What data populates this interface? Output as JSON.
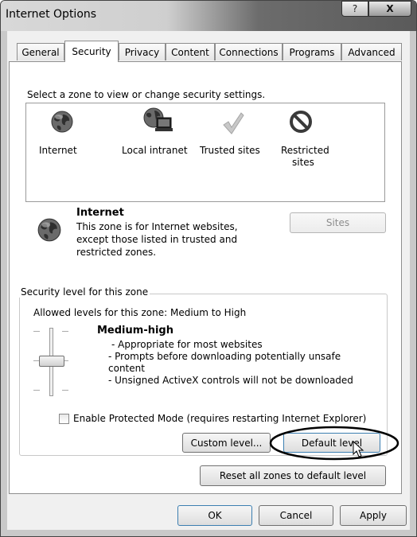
{
  "window": {
    "title": "Internet Options",
    "help_label": "?",
    "close_label": "X"
  },
  "tabs": [
    {
      "label": "General"
    },
    {
      "label": "Security",
      "active": true
    },
    {
      "label": "Privacy"
    },
    {
      "label": "Content"
    },
    {
      "label": "Connections"
    },
    {
      "label": "Programs"
    },
    {
      "label": "Advanced"
    }
  ],
  "zones": {
    "prompt": "Select a zone to view or change security settings.",
    "items": [
      {
        "label": "Internet",
        "icon": "globe-icon"
      },
      {
        "label": "Local intranet",
        "icon": "intranet-icon"
      },
      {
        "label": "Trusted sites",
        "icon": "checkmark-icon"
      },
      {
        "label": "Restricted sites",
        "label_line1": "Restricted",
        "label_line2": "sites",
        "icon": "blocked-icon"
      }
    ]
  },
  "selected_zone": {
    "name": "Internet",
    "description_line1": "This zone is for Internet websites,",
    "description_line2": "except those listed in trusted and",
    "description_line3": "restricted zones.",
    "sites_button": "Sites"
  },
  "security_level": {
    "group_title": "Security level for this zone",
    "allowed": "Allowed levels for this zone: Medium to High",
    "level_name": "Medium-high",
    "bullet1": "- Appropriate for most websites",
    "bullet2_line1": "- Prompts before downloading potentially unsafe",
    "bullet2_line2": "content",
    "bullet3": "- Unsigned ActiveX controls will not be downloaded",
    "slider_level": "Medium-high",
    "protected_mode_label": "Enable Protected Mode (requires restarting Internet Explorer)",
    "protected_mode_checked": false,
    "custom_level_button": "Custom level...",
    "default_level_button": "Default level"
  },
  "reset_all_button": "Reset all zones to default level",
  "footer": {
    "ok": "OK",
    "cancel": "Cancel",
    "apply": "Apply"
  }
}
